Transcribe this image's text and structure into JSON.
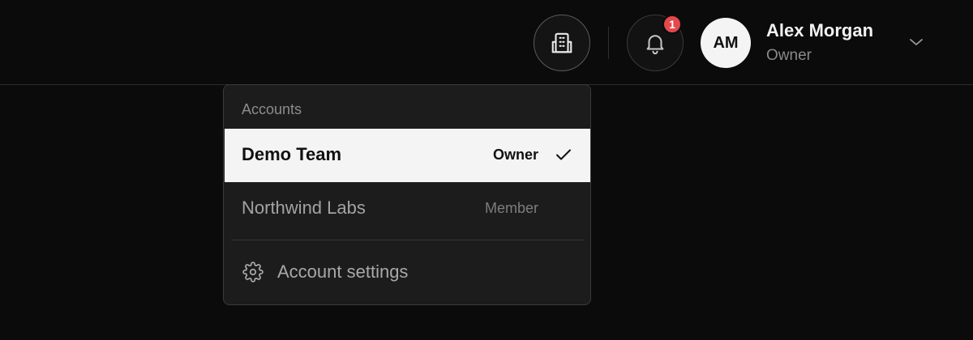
{
  "header": {
    "notifications": {
      "count": "1"
    },
    "user": {
      "initials": "AM",
      "name": "Alex Morgan",
      "role": "Owner"
    }
  },
  "dropdown": {
    "section_label": "Accounts",
    "accounts": [
      {
        "name": "Demo Team",
        "role": "Owner",
        "selected": true
      },
      {
        "name": "Northwind Labs",
        "role": "Member",
        "selected": false
      }
    ],
    "settings_label": "Account settings"
  },
  "icons": {
    "accounts_button": "building-icon",
    "notifications_button": "bell-icon",
    "user_menu": "chevron-down-icon",
    "selected_marker": "check-icon",
    "settings": "gear-icon"
  },
  "colors": {
    "background": "#0b0b0b",
    "menu_background": "#1c1c1c",
    "selected_row": "#f4f4f4",
    "badge": "#e5484d"
  }
}
